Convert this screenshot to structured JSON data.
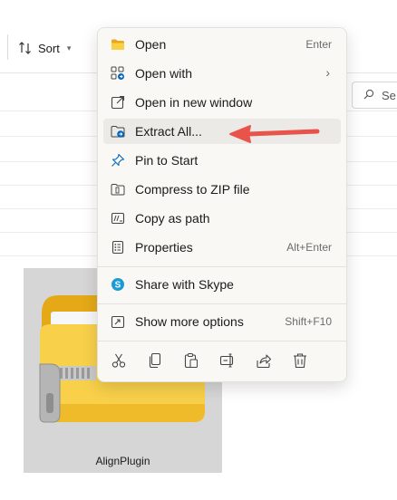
{
  "toolbar": {
    "sort_label": "Sort"
  },
  "search": {
    "placeholder_fragment": "Se"
  },
  "file": {
    "name": "AlignPlugin"
  },
  "context_menu": {
    "items": [
      {
        "label": "Open",
        "shortcut": "Enter",
        "icon": "folder-icon"
      },
      {
        "label": "Open with",
        "shortcut": "",
        "icon": "open-with-icon",
        "submenu": true
      },
      {
        "label": "Open in new window",
        "shortcut": "",
        "icon": "new-window-icon"
      },
      {
        "label": "Extract All...",
        "shortcut": "",
        "icon": "extract-icon",
        "highlighted": true
      },
      {
        "label": "Pin to Start",
        "shortcut": "",
        "icon": "pin-icon"
      },
      {
        "label": "Compress to ZIP file",
        "shortcut": "",
        "icon": "zip-icon"
      },
      {
        "label": "Copy as path",
        "shortcut": "",
        "icon": "copy-path-icon"
      },
      {
        "label": "Properties",
        "shortcut": "Alt+Enter",
        "icon": "properties-icon"
      },
      {
        "label": "Share with Skype",
        "shortcut": "",
        "icon": "skype-icon"
      },
      {
        "label": "Show more options",
        "shortcut": "Shift+F10",
        "icon": "more-options-icon"
      }
    ],
    "bottom_actions": [
      "cut-icon",
      "copy-icon",
      "paste-icon",
      "rename-icon",
      "share-icon",
      "delete-icon"
    ]
  },
  "annotation": {
    "arrow_color": "#e8534a"
  },
  "colors": {
    "accent": "#0067c0",
    "folder_yellow": "#f5c242",
    "menu_bg": "#faf8f5"
  }
}
